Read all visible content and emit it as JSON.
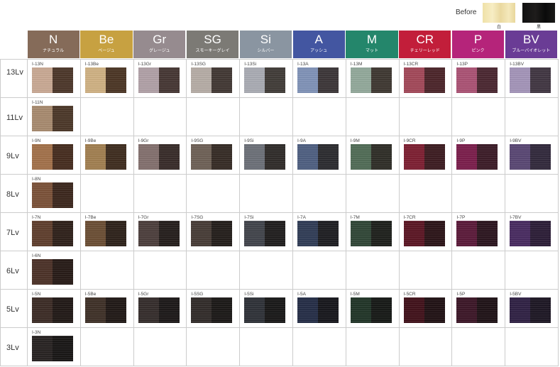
{
  "legend": {
    "before_label": "Before",
    "white_caption": "白",
    "black_caption": "黒"
  },
  "headers": [
    {
      "code": "N",
      "jp": "ナチュラル",
      "color": "#856b59"
    },
    {
      "code": "Be",
      "jp": "ベージュ",
      "color": "#c7a141"
    },
    {
      "code": "Gr",
      "jp": "グレージュ",
      "color": "#968b8f"
    },
    {
      "code": "SG",
      "jp": "スモーキーグレイ",
      "color": "#7c7a75"
    },
    {
      "code": "Si",
      "jp": "シルバー",
      "color": "#8a95a1"
    },
    {
      "code": "A",
      "jp": "アッシュ",
      "color": "#4356a1"
    },
    {
      "code": "M",
      "jp": "マット",
      "color": "#24866b"
    },
    {
      "code": "CR",
      "jp": "チェリーレッド",
      "color": "#c21e3a"
    },
    {
      "code": "P",
      "jp": "ピンク",
      "color": "#b5247a"
    },
    {
      "code": "BV",
      "jp": "ブルーバイオレット",
      "color": "#6a3c95"
    }
  ],
  "rows": [
    {
      "level": "13Lv",
      "cells": [
        {
          "label": "I-13N",
          "a": "#c9a893",
          "b": "#4b3528"
        },
        {
          "label": "I-13Be",
          "a": "#cfb182",
          "b": "#4a3423"
        },
        {
          "label": "I-13Gr",
          "a": "#b0a0a6",
          "b": "#443532"
        },
        {
          "label": "I-13SG",
          "a": "#b5aca5",
          "b": "#403632"
        },
        {
          "label": "I-13Si",
          "a": "#a9abb3",
          "b": "#3f3a36"
        },
        {
          "label": "I-13A",
          "a": "#7f92b7",
          "b": "#3a3436"
        },
        {
          "label": "I-13M",
          "a": "#92a89a",
          "b": "#3d3630"
        },
        {
          "label": "I-13CR",
          "a": "#a24758",
          "b": "#4a2328"
        },
        {
          "label": "I-13P",
          "a": "#aa5173",
          "b": "#49252f"
        },
        {
          "label": "I-13BV",
          "a": "#a394b8",
          "b": "#3f3440"
        }
      ]
    },
    {
      "level": "11Lv",
      "cells": [
        {
          "label": "I-11N",
          "a": "#a78a6e",
          "b": "#4a3627"
        }
      ]
    },
    {
      "level": "9Lv",
      "cells": [
        {
          "label": "I-9N",
          "a": "#a27049",
          "b": "#442b1d"
        },
        {
          "label": "I-9Be",
          "a": "#a17e4f",
          "b": "#3d2b1d"
        },
        {
          "label": "I-9Gr",
          "a": "#826f6d",
          "b": "#362a27"
        },
        {
          "label": "I-9SG",
          "a": "#6d5f55",
          "b": "#342a24"
        },
        {
          "label": "I-9Si",
          "a": "#6b6f77",
          "b": "#2e2a28"
        },
        {
          "label": "I-9A",
          "a": "#4d5e80",
          "b": "#2a2a2e"
        },
        {
          "label": "I-9M",
          "a": "#4f6b55",
          "b": "#2d2c25"
        },
        {
          "label": "I-9CR",
          "a": "#7c1d30",
          "b": "#3b1a1f"
        },
        {
          "label": "I-9P",
          "a": "#7a1c4a",
          "b": "#3a1a26"
        },
        {
          "label": "I-9BV",
          "a": "#584572",
          "b": "#30273a"
        }
      ]
    },
    {
      "level": "8Lv",
      "cells": [
        {
          "label": "I-8N",
          "a": "#7a5037",
          "b": "#3a251b"
        }
      ]
    },
    {
      "level": "7Lv",
      "cells": [
        {
          "label": "I-7N",
          "a": "#5e3d2c",
          "b": "#2d1f18"
        },
        {
          "label": "I-7Be",
          "a": "#6a4d33",
          "b": "#2c2018"
        },
        {
          "label": "I-7Gr",
          "a": "#4b3d3b",
          "b": "#231c1a"
        },
        {
          "label": "I-7SG",
          "a": "#463b35",
          "b": "#221c19"
        },
        {
          "label": "I-7Si",
          "a": "#40434a",
          "b": "#1e1c1c"
        },
        {
          "label": "I-7A",
          "a": "#2f3b55",
          "b": "#1c1c20"
        },
        {
          "label": "I-7M",
          "a": "#2f4535",
          "b": "#1c1e1a"
        },
        {
          "label": "I-7CR",
          "a": "#5a1422",
          "b": "#2a1216"
        },
        {
          "label": "I-7P",
          "a": "#5a1838",
          "b": "#2a131d"
        },
        {
          "label": "I-7BV",
          "a": "#47295f",
          "b": "#2a1b35"
        }
      ]
    },
    {
      "level": "6Lv",
      "cells": [
        {
          "label": "I-6N",
          "a": "#4a3026",
          "b": "#251915"
        }
      ]
    },
    {
      "level": "5Lv",
      "cells": [
        {
          "label": "I-5N",
          "a": "#3a2a24",
          "b": "#1f1714"
        },
        {
          "label": "I-5Be",
          "a": "#3d2f26",
          "b": "#1e1714"
        },
        {
          "label": "I-5Gr",
          "a": "#332b2a",
          "b": "#1a1616"
        },
        {
          "label": "I-5SG",
          "a": "#302a28",
          "b": "#191615"
        },
        {
          "label": "I-5Si",
          "a": "#2d3036",
          "b": "#171616"
        },
        {
          "label": "I-5A",
          "a": "#232c45",
          "b": "#15151a"
        },
        {
          "label": "I-5M",
          "a": "#1f3326",
          "b": "#141714"
        },
        {
          "label": "I-5CR",
          "a": "#3f0f18",
          "b": "#1e0f12"
        },
        {
          "label": "I-5P",
          "a": "#3a1425",
          "b": "#1d1015"
        },
        {
          "label": "I-5BV",
          "a": "#2e1f42",
          "b": "#1b1522"
        }
      ]
    },
    {
      "level": "3Lv",
      "cells": [
        {
          "label": "I-3N",
          "a": "#262120",
          "b": "#161413"
        }
      ]
    }
  ]
}
